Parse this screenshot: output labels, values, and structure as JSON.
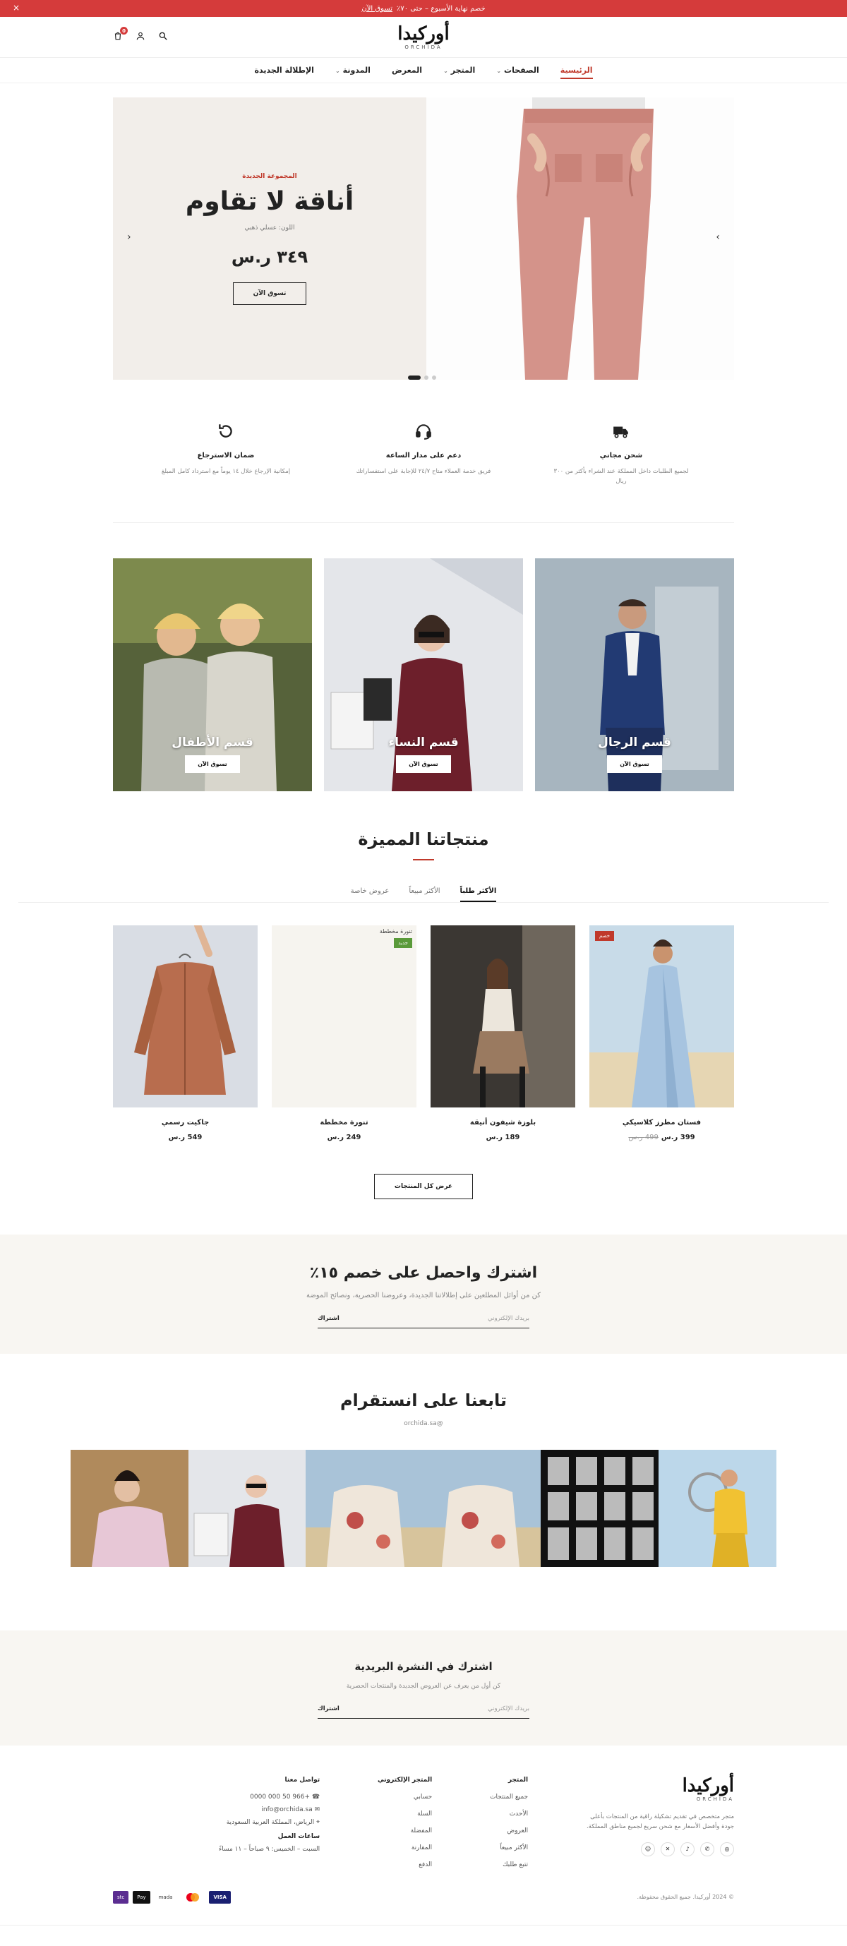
{
  "topbar": {
    "text": "خصم نهاية الأسبوع – حتى ٧٠٪",
    "link": "تسوق الآن",
    "close": "×"
  },
  "brand": {
    "name_ar": "أوركيدا",
    "name_en": "ORCHIDA"
  },
  "header": {
    "cart_count": "0"
  },
  "nav": [
    {
      "label": "الرئيسية",
      "active": true
    },
    {
      "label": "الصفحات",
      "dropdown": true
    },
    {
      "label": "المتجر",
      "dropdown": true
    },
    {
      "label": "المعرض"
    },
    {
      "label": "المدونة",
      "dropdown": true
    },
    {
      "label": "الإطلالة الجديدة"
    }
  ],
  "hero": {
    "tag": "المجموعة الجديدة",
    "title": "أناقة لا تقاوم",
    "subtitle": "اللون: عسلي ذهبي",
    "price": "٣٤٩ ر.س",
    "button": "تسوق الآن"
  },
  "features": [
    {
      "title": "شحن مجاني",
      "text": "لجميع الطلبات داخل المملكة عند الشراء بأكثر من ٣٠٠ ريال",
      "icon": "truck-icon"
    },
    {
      "title": "دعم على مدار الساعة",
      "text": "فريق خدمة العملاء متاح ٢٤/٧ للإجابة على استفساراتك",
      "icon": "headset-icon"
    },
    {
      "title": "ضمان الاسترجاع",
      "text": "إمكانية الإرجاع خلال ١٤ يوماً مع استرداد كامل المبلغ",
      "icon": "return-icon"
    }
  ],
  "categories": [
    {
      "title": "قسم الرجال",
      "button": "تسوق الآن"
    },
    {
      "title": "قسم النساء",
      "button": "تسوق الآن"
    },
    {
      "title": "قسم الأطفال",
      "button": "تسوق الآن"
    }
  ],
  "featured": {
    "title": "منتجاتنا المميزة",
    "tabs": [
      "الأكثر طلباً",
      "الأكثر مبيعاً",
      "عروض خاصة"
    ],
    "products": [
      {
        "name": "فستان مطرز كلاسيكي",
        "price": "399 ر.س",
        "old_price": "499 ر.س",
        "badge": "خصم"
      },
      {
        "name": "بلوزة شيفون أنيقة",
        "price": "189 ر.س"
      },
      {
        "name": "تنورة مخططة",
        "price": "249 ر.س",
        "badge": "جديد",
        "img_alt": "تنورة مخططة"
      },
      {
        "name": "جاكيت رسمي",
        "price": "549 ر.س"
      }
    ],
    "view_all": "عرض كل المنتجات"
  },
  "subscribe": {
    "title": "اشترك واحصل على خصم ١٥٪",
    "text": "كن من أوائل المطلعين على إطلالاتنا الجديدة، وعروضنا الحصرية، ونصائح الموضة",
    "placeholder": "بريدك الإلكتروني",
    "button": "اشتراك"
  },
  "instagram": {
    "title": "تابعنا على انستقرام",
    "handle": "@orchida.sa"
  },
  "newsletter": {
    "title": "اشترك في النشرة البريدية",
    "text": "كن أول من يعرف عن العروض الجديدة والمنتجات الحصرية",
    "placeholder": "بريدك الإلكتروني",
    "button": "اشتراك"
  },
  "footer": {
    "about": "متجر متخصص في تقديم تشكيلة راقية من المنتجات بأعلى جودة وأفضل الأسعار مع شحن سريع لجميع مناطق المملكة.",
    "store_title": "المتجر",
    "store_links": [
      "جميع المنتجات",
      "الأحدث",
      "العروض",
      "الأكثر مبيعاً",
      "تتبع طلبك"
    ],
    "account_title": "المتجر الإلكتروني",
    "account_links": [
      "حسابي",
      "السلة",
      "المفضلة",
      "المقارنة",
      "الدفع"
    ],
    "contact_title": "تواصل معنا",
    "phone": "+966 50 000 0000",
    "email": "info@orchida.sa",
    "address": "الرياض، المملكة العربية السعودية",
    "hours_title": "ساعات العمل",
    "hours": "السبت – الخميس: ٩ صباحاً – ١١ مساءً",
    "copyright": "© 2024 أوركيدا. جميع الحقوق محفوظة."
  },
  "payments": [
    "VISA",
    "mada",
    "Pay",
    "stc"
  ],
  "colors": {
    "accent": "#c0392b",
    "topbar": "#d53b3b"
  }
}
